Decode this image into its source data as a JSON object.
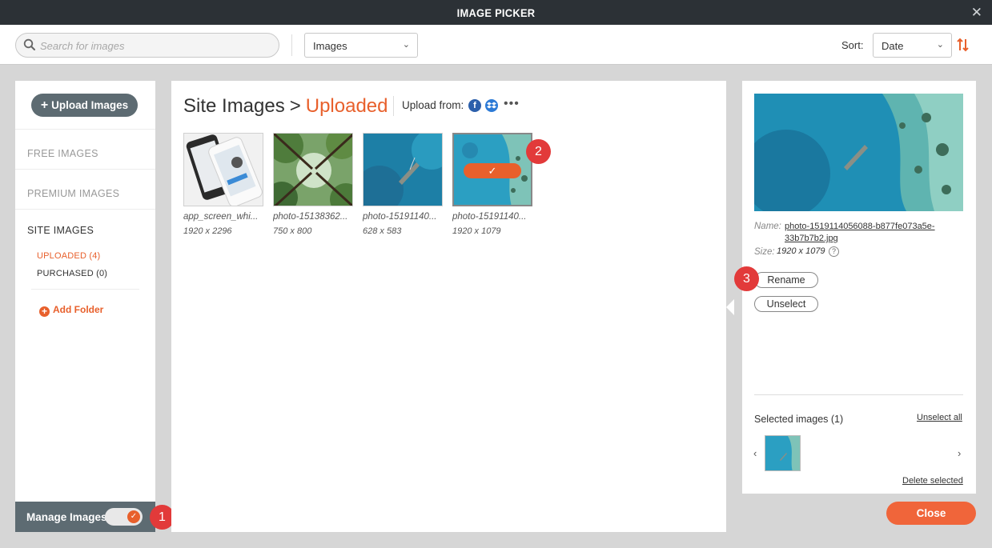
{
  "window": {
    "title": "IMAGE PICKER",
    "close_glyph": "✕"
  },
  "toolbar": {
    "search_placeholder": "Search for images",
    "type_select": "Images",
    "sort_label": "Sort:",
    "sort_select": "Date"
  },
  "sidebar": {
    "upload_label": "Upload Images",
    "categories": [
      "FREE IMAGES",
      "PREMIUM IMAGES",
      "SITE IMAGES"
    ],
    "subfolders": [
      "UPLOADED (4)",
      "PURCHASED (0)"
    ],
    "add_folder_label": "Add Folder",
    "manage_label": "Manage Images",
    "manage_enabled": true
  },
  "breadcrumb": {
    "parent": "Site Images",
    "separator": ">",
    "current": "Uploaded"
  },
  "upload_from_label": "Upload from:",
  "thumbnails": [
    {
      "name": "app_screen_whi...",
      "size": "1920 x 2296"
    },
    {
      "name": "photo-15138362...",
      "size": "750 x 800"
    },
    {
      "name": "photo-15191140...",
      "size": "628 x 583"
    },
    {
      "name": "photo-15191140...",
      "size": "1920 x 1079",
      "selected": true
    }
  ],
  "details": {
    "name_key": "Name:",
    "name_line1": "photo-1519114056088-b877fe073a5e-",
    "name_line2": "33b7b7b2.jpg",
    "size_key": "Size:",
    "size_value": "1920 x 1079",
    "rename_label": "Rename",
    "unselect_label": "Unselect"
  },
  "selection": {
    "title": "Selected images (1)",
    "unselect_all": "Unselect all",
    "delete_selected": "Delete selected"
  },
  "close_label": "Close",
  "badges": [
    "1",
    "2",
    "3"
  ],
  "colors": {
    "accent": "#e8602c",
    "badge": "#e23a3a",
    "sidebar_button": "#5d6b72",
    "titlebar": "#2c3136"
  }
}
